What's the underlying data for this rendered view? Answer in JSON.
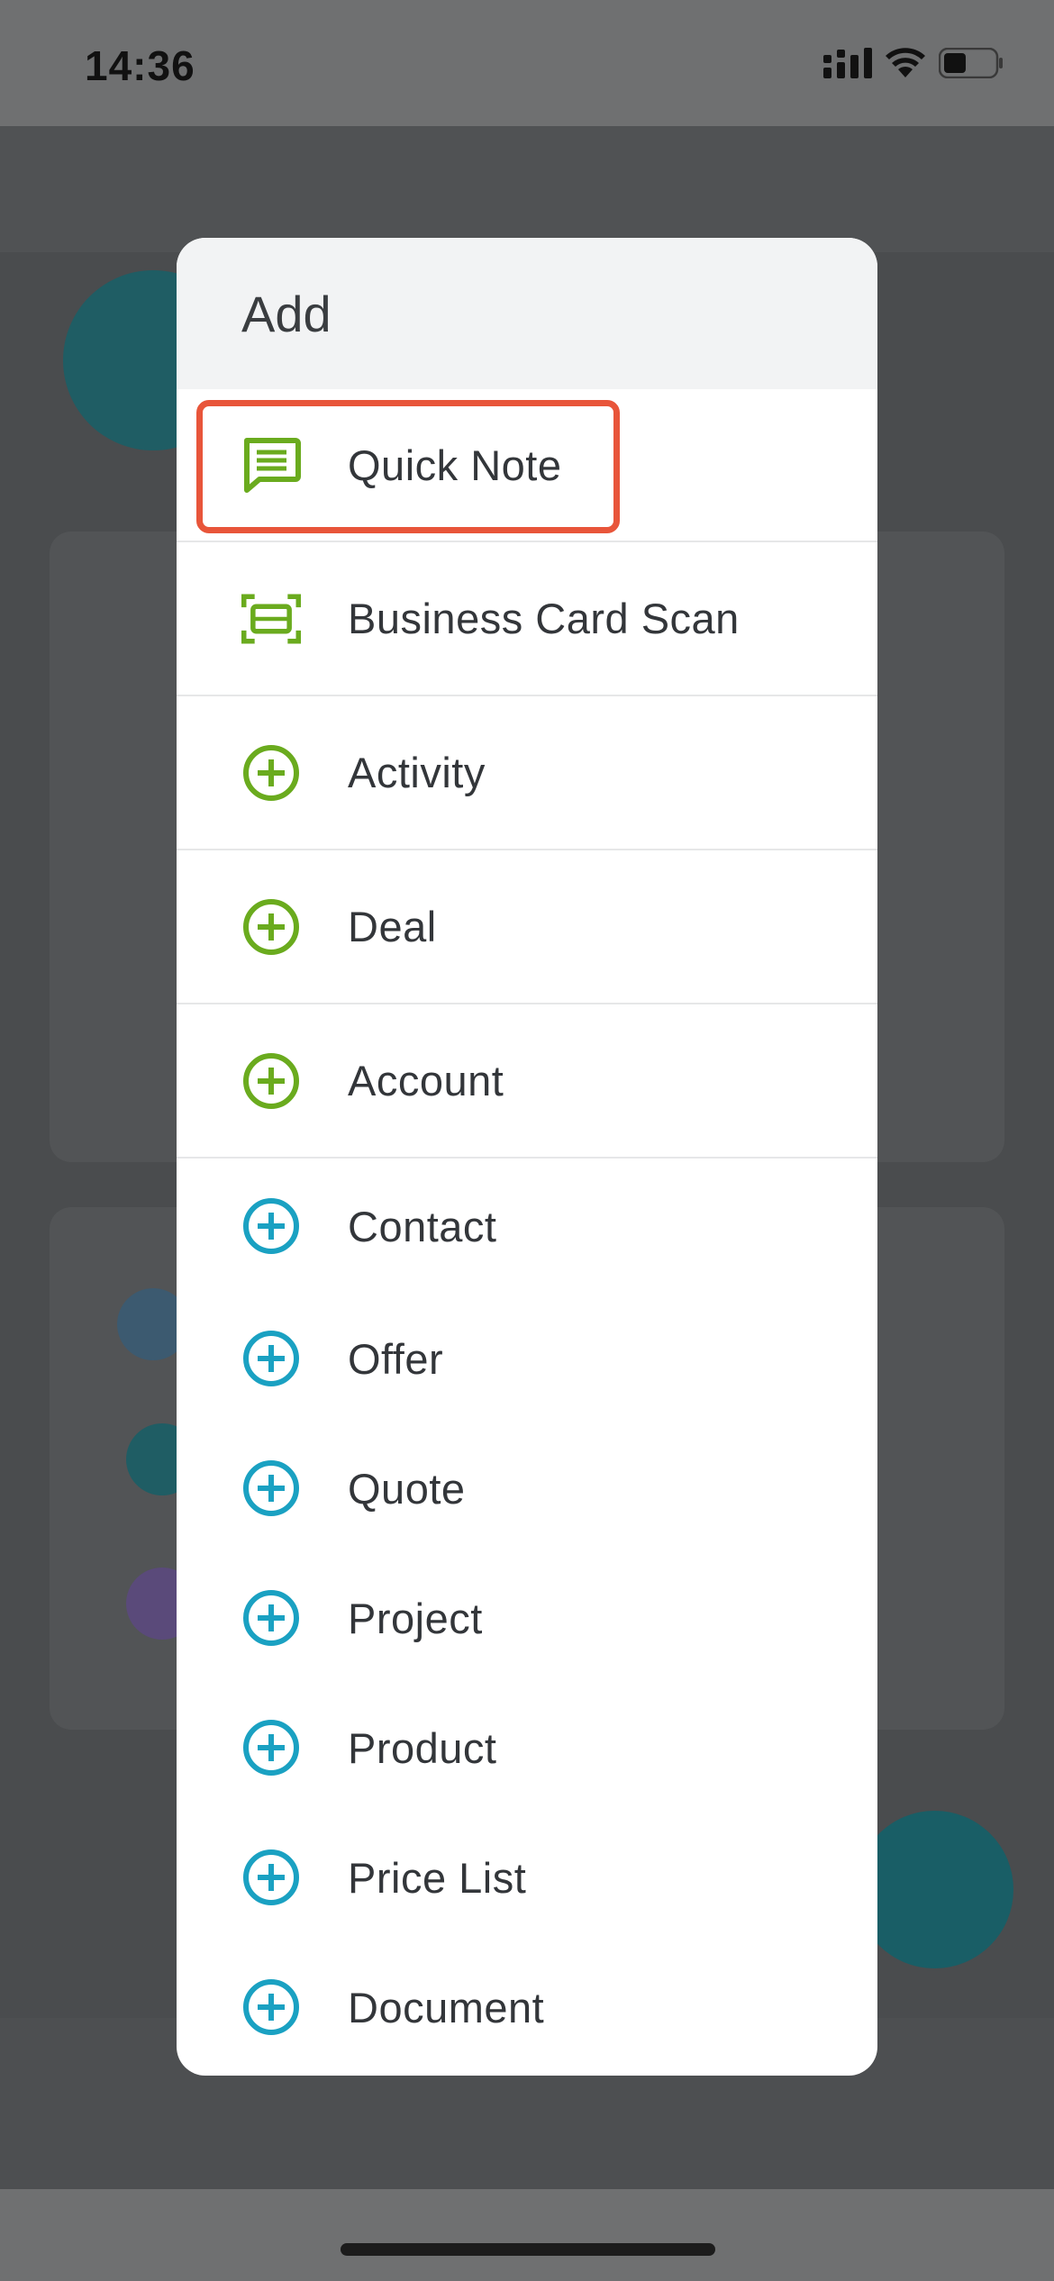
{
  "status_bar": {
    "time": "14:36"
  },
  "modal": {
    "title": "Add",
    "items": [
      {
        "label": "Quick Note",
        "icon": "chat-note-icon",
        "color": "#6aab1e"
      },
      {
        "label": "Business Card Scan",
        "icon": "scan-card-icon",
        "color": "#6aab1e"
      },
      {
        "label": "Activity",
        "icon": "plus-circle-icon",
        "color": "#6aab1e"
      },
      {
        "label": "Deal",
        "icon": "plus-circle-icon",
        "color": "#6aab1e"
      },
      {
        "label": "Account",
        "icon": "plus-circle-icon",
        "color": "#6aab1e"
      },
      {
        "label": "Contact",
        "icon": "plus-circle-icon",
        "color": "#1aa1c2"
      },
      {
        "label": "Offer",
        "icon": "plus-circle-icon",
        "color": "#1aa1c2"
      },
      {
        "label": "Quote",
        "icon": "plus-circle-icon",
        "color": "#1aa1c2"
      },
      {
        "label": "Project",
        "icon": "plus-circle-icon",
        "color": "#1aa1c2"
      },
      {
        "label": "Product",
        "icon": "plus-circle-icon",
        "color": "#1aa1c2"
      },
      {
        "label": "Price List",
        "icon": "plus-circle-icon",
        "color": "#1aa1c2"
      },
      {
        "label": "Document",
        "icon": "plus-circle-icon",
        "color": "#1aa1c2"
      }
    ]
  },
  "colors": {
    "highlight": "#e8553a",
    "green": "#6aab1e",
    "teal": "#1aa1c2"
  }
}
